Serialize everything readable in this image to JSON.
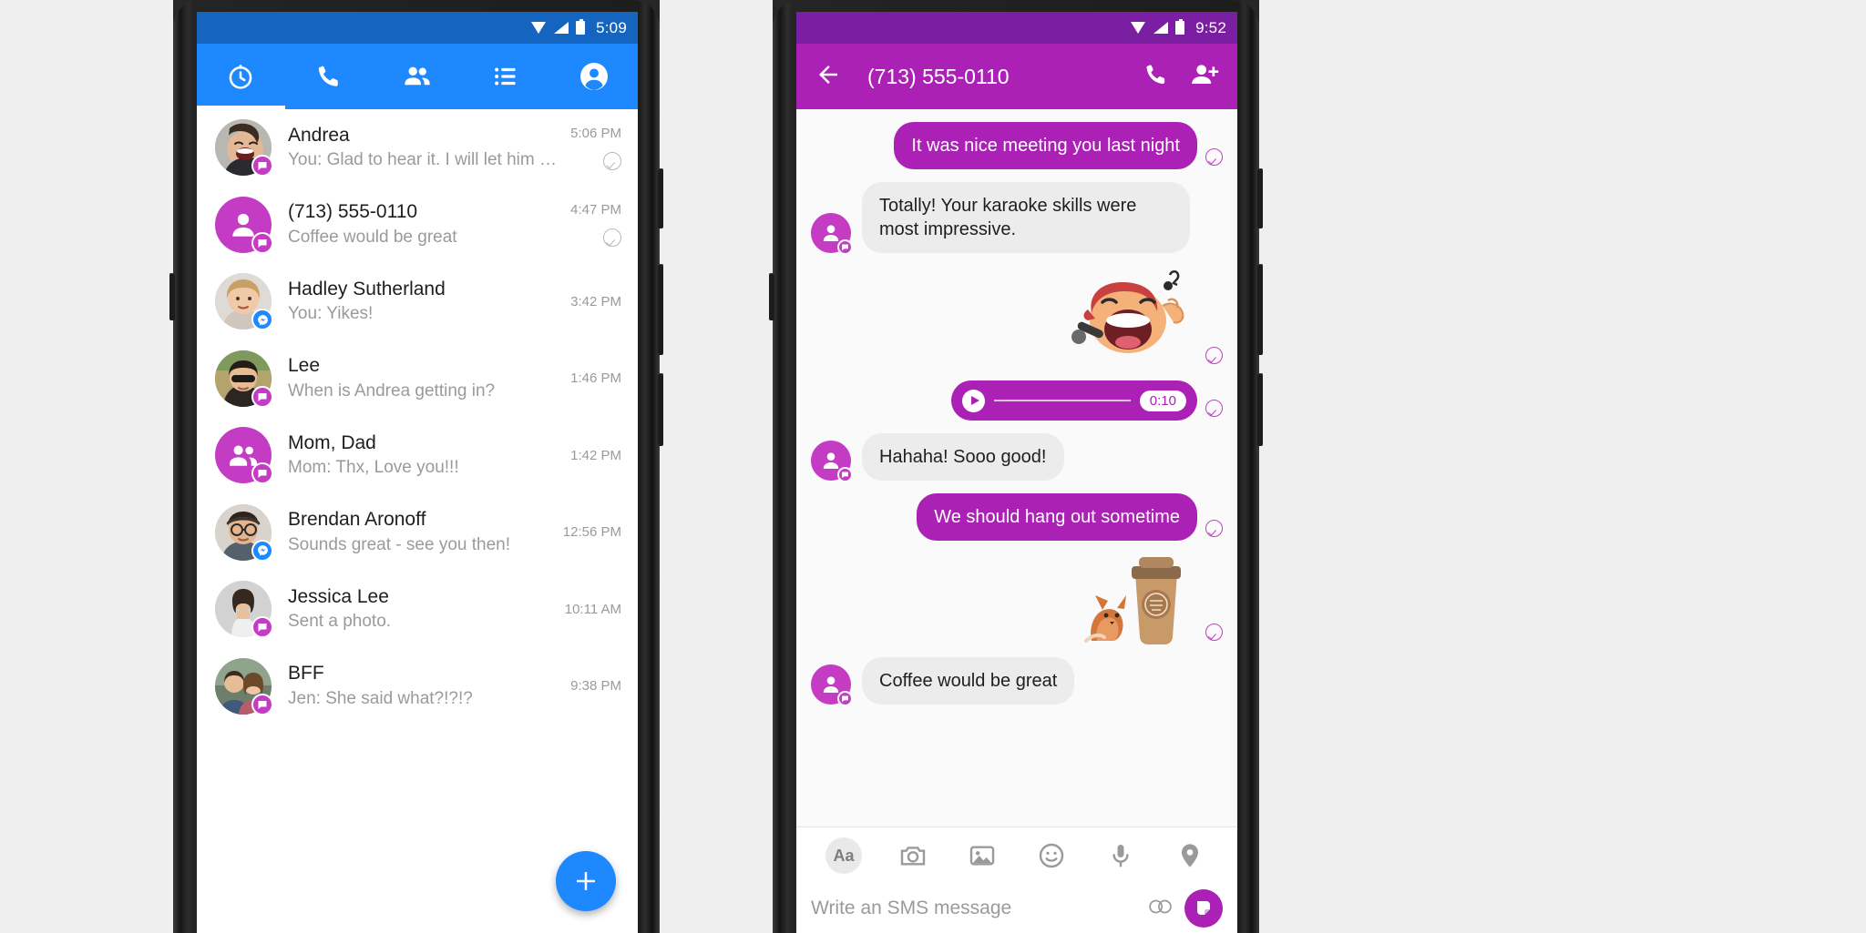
{
  "meta": {
    "accent_blue": "#1e88ff",
    "accent_blue_dark": "#1565c0",
    "accent_purple": "#ab20b5",
    "accent_purple_light": "#c43cc4",
    "accent_purple_dark": "#7b1fa2",
    "text_primary": "#1c1e21",
    "text_secondary": "#9a9a9a"
  },
  "left_phone": {
    "statusbar": {
      "time": "5:09",
      "wifi_icon": "wifi-icon",
      "signal_icon": "signal-icon",
      "battery_icon": "battery-icon"
    },
    "tabs": [
      {
        "key": "recents",
        "icon": "clock-icon",
        "label": "Recents",
        "active": true
      },
      {
        "key": "calls",
        "icon": "phone-icon",
        "label": "Calls",
        "active": false
      },
      {
        "key": "people",
        "icon": "people-icon",
        "label": "People",
        "active": false
      },
      {
        "key": "groups",
        "icon": "list-icon",
        "label": "Groups",
        "active": false
      },
      {
        "key": "profile",
        "icon": "person-circle-icon",
        "label": "Me",
        "active": false
      }
    ],
    "conversations": [
      {
        "name": "Andrea",
        "snippet": "You: Glad to hear it. I will let him know..",
        "time": "5:06 PM",
        "avatar": "photo-man-laughing",
        "badge": "sms",
        "sent": true
      },
      {
        "name": "(713) 555-0110",
        "snippet": "Coffee would be great",
        "time": "4:47 PM",
        "avatar": "placeholder-person",
        "badge": "sms",
        "sent": true
      },
      {
        "name": "Hadley Sutherland",
        "snippet": "You: Yikes!",
        "time": "3:42 PM",
        "avatar": "photo-woman-blonde",
        "badge": "messenger",
        "sent": false
      },
      {
        "name": "Lee",
        "snippet": "When is Andrea getting in?",
        "time": "1:46 PM",
        "avatar": "photo-woman-sunglasses",
        "badge": "sms",
        "sent": false
      },
      {
        "name": "Mom, Dad",
        "snippet": "Mom: Thx, Love you!!!",
        "time": "1:42 PM",
        "avatar": "placeholder-group",
        "badge": "sms",
        "sent": false
      },
      {
        "name": "Brendan Aronoff",
        "snippet": "Sounds great - see you then!",
        "time": "12:56 PM",
        "avatar": "photo-man-glasses",
        "badge": "messenger",
        "sent": false
      },
      {
        "name": "Jessica Lee",
        "snippet": "Sent a photo.",
        "time": "10:11 AM",
        "avatar": "photo-woman-standing",
        "badge": "sms",
        "sent": false
      },
      {
        "name": "BFF",
        "snippet": "Jen: She said what?!?!?",
        "time": "9:38 PM",
        "avatar": "photo-couple",
        "badge": "sms",
        "sent": false
      }
    ],
    "fab": {
      "icon": "plus-icon",
      "label": "New message"
    }
  },
  "right_phone": {
    "statusbar": {
      "time": "9:52",
      "wifi_icon": "wifi-icon",
      "signal_icon": "signal-icon",
      "battery_icon": "battery-icon"
    },
    "header": {
      "back_icon": "arrow-left-icon",
      "title": "(713) 555-0110",
      "call_icon": "phone-icon",
      "add_person_icon": "person-add-icon"
    },
    "messages": [
      {
        "type": "text",
        "dir": "out",
        "text": "It was nice meeting you last night",
        "sent": true
      },
      {
        "type": "text",
        "dir": "in",
        "text": "Totally! Your karaoke skills were most impressive.",
        "sent": false
      },
      {
        "type": "sticker",
        "dir": "out",
        "sticker": "karaoke-singer-sticker",
        "sent": true
      },
      {
        "type": "audio",
        "dir": "out",
        "duration": "0:10",
        "play_icon": "play-icon",
        "sent": true
      },
      {
        "type": "text",
        "dir": "in",
        "text": "Hahaha! Sooo good!",
        "sent": false
      },
      {
        "type": "text",
        "dir": "out",
        "text": "We should hang out sometime",
        "sent": true
      },
      {
        "type": "sticker",
        "dir": "out",
        "sticker": "coffee-cup-fox-sticker",
        "sent": true
      },
      {
        "type": "text",
        "dir": "in",
        "text": "Coffee would be great",
        "sent": false
      }
    ],
    "composer": {
      "icons": [
        {
          "key": "text",
          "icon": "aa-text-icon",
          "label": "Aa"
        },
        {
          "key": "camera",
          "icon": "camera-icon",
          "label": "Camera"
        },
        {
          "key": "gallery",
          "icon": "image-icon",
          "label": "Gallery"
        },
        {
          "key": "stickers",
          "icon": "smiley-icon",
          "label": "Stickers"
        },
        {
          "key": "voice",
          "icon": "microphone-icon",
          "label": "Voice"
        },
        {
          "key": "location",
          "icon": "location-pin-icon",
          "label": "Location"
        }
      ],
      "placeholder": "Write an SMS message",
      "emoji_icon": "emoji-icon",
      "send_icon": "send-sticker-icon"
    }
  }
}
